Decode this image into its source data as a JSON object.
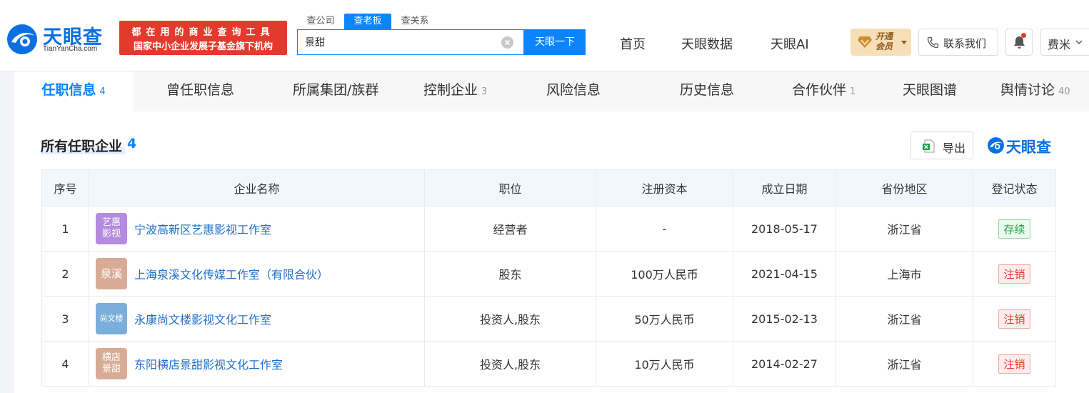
{
  "header": {
    "logo_text": "天眼查",
    "logo_sub": "TianYanCha.com",
    "slogan_line1": "都在用的商业查询工具",
    "slogan_line2": "国家中小企业发展子基金旗下机构",
    "search_tabs": [
      "查公司",
      "查老板",
      "查关系"
    ],
    "search_value": "景甜",
    "search_button": "天眼一下",
    "nav": [
      "首页",
      "天眼数据",
      "天眼AI"
    ],
    "vip_line1": "开通",
    "vip_line2": "会员",
    "contact_label": "联系我们",
    "user_label": "费米"
  },
  "tabs": [
    {
      "label": "任职信息",
      "count": "4"
    },
    {
      "label": "曾任职信息",
      "count": ""
    },
    {
      "label": "所属集团/族群",
      "count": ""
    },
    {
      "label": "控制企业",
      "count": "3"
    },
    {
      "label": "风险信息",
      "count": ""
    },
    {
      "label": "历史信息",
      "count": ""
    },
    {
      "label": "合作伙伴",
      "count": "1"
    },
    {
      "label": "天眼图谱",
      "count": ""
    },
    {
      "label": "舆情讨论",
      "count": "40"
    }
  ],
  "section": {
    "title": "所有任职企业",
    "count": "4",
    "export_label": "导出",
    "watermark": "天眼查"
  },
  "table": {
    "headers": [
      "序号",
      "企业名称",
      "职位",
      "注册资本",
      "成立日期",
      "省份地区",
      "登记状态"
    ],
    "rows": [
      {
        "no": "1",
        "logo": "艺惠影视",
        "logo_color": "#b48be0",
        "name": "宁波高新区艺惠影视工作室",
        "position": "经营者",
        "capital": "-",
        "date": "2018-05-17",
        "region": "浙江省",
        "status": "存续"
      },
      {
        "no": "2",
        "logo": "泉溪",
        "logo_color": "#d8ab96",
        "name": "上海泉溪文化传媒工作室（有限合伙）",
        "position": "股东",
        "capital": "100万人民币",
        "date": "2021-04-15",
        "region": "上海市",
        "status": "注销"
      },
      {
        "no": "3",
        "logo": "尚文楼",
        "logo_color": "#7aaedb",
        "name": "永康尚文楼影视文化工作室",
        "position": "投资人,股东",
        "capital": "50万人民币",
        "date": "2015-02-13",
        "region": "浙江省",
        "status": "注销"
      },
      {
        "no": "4",
        "logo": "横店景甜",
        "logo_color": "#d8ab96",
        "name": "东阳横店景甜影视文化工作室",
        "position": "投资人,股东",
        "capital": "10万人民币",
        "date": "2014-02-27",
        "region": "浙江省",
        "status": "注销"
      }
    ]
  },
  "colors": {
    "accent": "#0a84ff",
    "brand": "#0a6fe0",
    "slogan_bg": "#e33a2d",
    "status_active": "#27a745",
    "status_cancelled": "#e33a2d"
  },
  "icons": [
    "tianyancha-logo-icon",
    "clear-icon",
    "vip-diamond-icon",
    "phone-icon",
    "bell-icon",
    "excel-icon",
    "chevron-down-icon"
  ]
}
